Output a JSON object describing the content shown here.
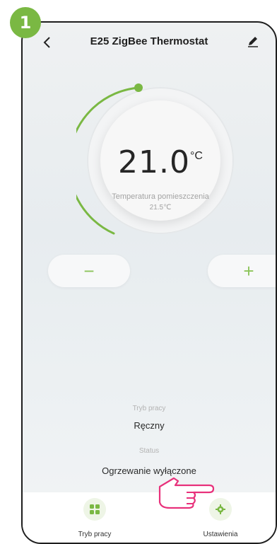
{
  "step_badge": "1",
  "header": {
    "title": "E25 ZigBee Thermostat",
    "back_icon": "chevron-left-icon",
    "edit_icon": "edit-pencil-icon"
  },
  "dial": {
    "setpoint": "21.0",
    "unit": "°C",
    "room_label": "Temperatura pomieszczenia",
    "room_temp": "21.5℃",
    "arc_color": "#7ab843"
  },
  "controls": {
    "minus": "−",
    "plus": "+"
  },
  "info": {
    "mode_label": "Tryb pracy",
    "mode_value": "Ręczny",
    "status_label": "Status",
    "status_value": "Ogrzewanie wyłączone"
  },
  "tabs": [
    {
      "label": "Tryb pracy",
      "icon": "grid-icon"
    },
    {
      "label": "Ustawienia",
      "icon": "gear-icon"
    }
  ]
}
